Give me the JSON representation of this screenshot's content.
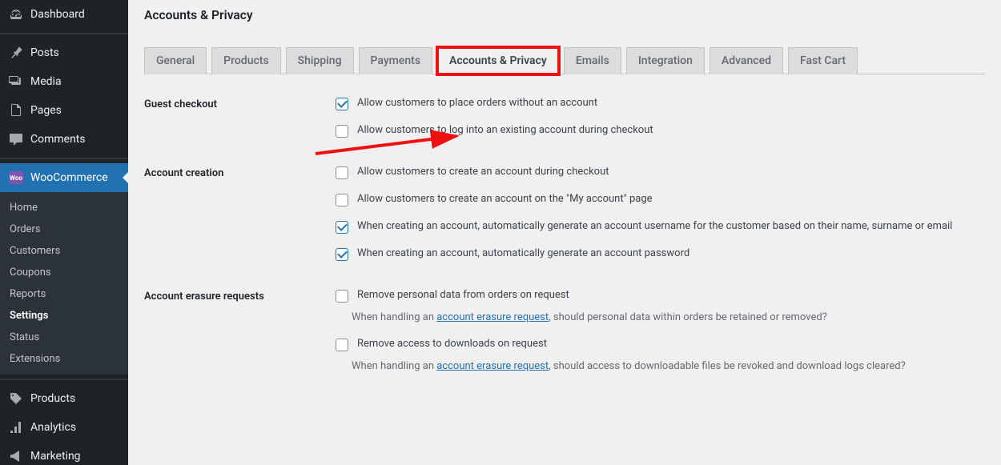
{
  "sidebar": {
    "items": [
      {
        "label": "Dashboard"
      },
      {
        "label": "Posts"
      },
      {
        "label": "Media"
      },
      {
        "label": "Pages"
      },
      {
        "label": "Comments"
      },
      {
        "label": "WooCommerce"
      },
      {
        "label": "Products"
      },
      {
        "label": "Analytics"
      },
      {
        "label": "Marketing"
      }
    ],
    "woosub": [
      {
        "label": "Home"
      },
      {
        "label": "Orders"
      },
      {
        "label": "Customers"
      },
      {
        "label": "Coupons"
      },
      {
        "label": "Reports"
      },
      {
        "label": "Settings"
      },
      {
        "label": "Status"
      },
      {
        "label": "Extensions"
      }
    ]
  },
  "page_title": "Accounts & Privacy",
  "tabs": [
    {
      "label": "General"
    },
    {
      "label": "Products"
    },
    {
      "label": "Shipping"
    },
    {
      "label": "Payments"
    },
    {
      "label": "Accounts & Privacy"
    },
    {
      "label": "Emails"
    },
    {
      "label": "Integration"
    },
    {
      "label": "Advanced"
    },
    {
      "label": "Fast Cart"
    }
  ],
  "sections": {
    "guest_checkout": {
      "title": "Guest checkout",
      "options": [
        {
          "label": "Allow customers to place orders without an account",
          "checked": true
        },
        {
          "label": "Allow customers to log into an existing account during checkout",
          "checked": false
        }
      ]
    },
    "account_creation": {
      "title": "Account creation",
      "options": [
        {
          "label": "Allow customers to create an account during checkout",
          "checked": false
        },
        {
          "label": "Allow customers to create an account on the \"My account\" page",
          "checked": false
        },
        {
          "label": "When creating an account, automatically generate an account username for the customer based on their name, surname or email",
          "checked": true
        },
        {
          "label": "When creating an account, automatically generate an account password",
          "checked": true
        }
      ]
    },
    "erasure": {
      "title": "Account erasure requests",
      "options": [
        {
          "label": "Remove personal data from orders on request",
          "checked": false,
          "help_pre": "When handling an ",
          "help_link": "account erasure request",
          "help_post": ", should personal data within orders be retained or removed?"
        },
        {
          "label": "Remove access to downloads on request",
          "checked": false,
          "help_pre": "When handling an ",
          "help_link": "account erasure request",
          "help_post": ", should access to downloadable files be revoked and download logs cleared?"
        }
      ]
    }
  },
  "woo_badge": "Woo"
}
